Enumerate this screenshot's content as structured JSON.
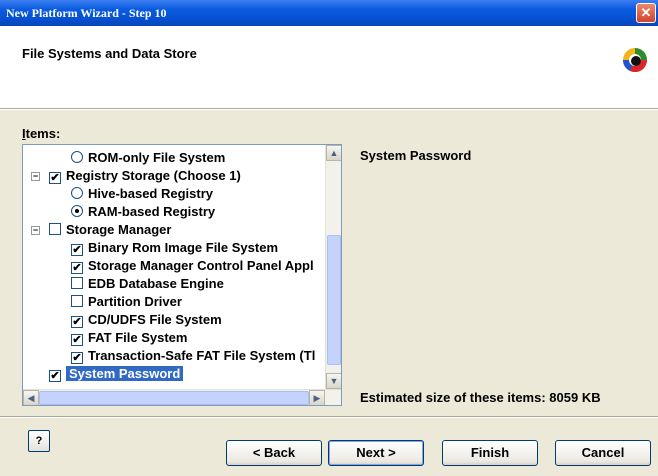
{
  "window": {
    "title": "New Platform Wizard - Step 10",
    "close_glyph": "✕"
  },
  "header": {
    "title": "File Systems and Data Store",
    "logo_icon": "wizard-logo-icon"
  },
  "items": {
    "label_prefix": "I",
    "label_rest": "tems:",
    "tree": [
      {
        "label": "ROM-only File System",
        "control": "radio",
        "checked": false,
        "indent": 1
      },
      {
        "label": "Registry Storage (Choose 1)",
        "control": "checkbox",
        "checked": true,
        "indent": 0,
        "expander": "−"
      },
      {
        "label": "Hive-based Registry",
        "control": "radio",
        "checked": false,
        "indent": 1
      },
      {
        "label": "RAM-based Registry",
        "control": "radio",
        "checked": true,
        "indent": 1
      },
      {
        "label": "Storage Manager",
        "control": "checkbox",
        "checked": false,
        "indent": 0,
        "expander": "−"
      },
      {
        "label": "Binary Rom Image File System",
        "control": "checkbox",
        "checked": true,
        "indent": 1
      },
      {
        "label": "Storage Manager Control Panel Appl",
        "control": "checkbox",
        "checked": true,
        "indent": 1
      },
      {
        "label": "EDB Database Engine",
        "control": "checkbox",
        "checked": false,
        "indent": 1
      },
      {
        "label": "Partition Driver",
        "control": "checkbox",
        "checked": false,
        "indent": 1
      },
      {
        "label": "CD/UDFS File System",
        "control": "checkbox",
        "checked": true,
        "indent": 1
      },
      {
        "label": "FAT File System",
        "control": "checkbox",
        "checked": true,
        "indent": 1
      },
      {
        "label": "Transaction-Safe FAT File System (Tl",
        "control": "checkbox",
        "checked": true,
        "indent": 1
      },
      {
        "label": "System Password",
        "control": "checkbox",
        "checked": true,
        "indent": 0,
        "selected": true
      }
    ],
    "scroll_up": "▲",
    "scroll_down": "▼",
    "scroll_left": "◀",
    "scroll_right": "▶"
  },
  "description": {
    "title": "System Password",
    "estimate": "Estimated size of these items: 8059 KB"
  },
  "buttons": {
    "help": "?",
    "back": "< Back",
    "next": "Next >",
    "finish": "Finish",
    "cancel": "Cancel"
  },
  "colors": {
    "titlebar": "#0551d4",
    "selection": "#316ac5",
    "dialog_bg": "#ece9d8"
  }
}
